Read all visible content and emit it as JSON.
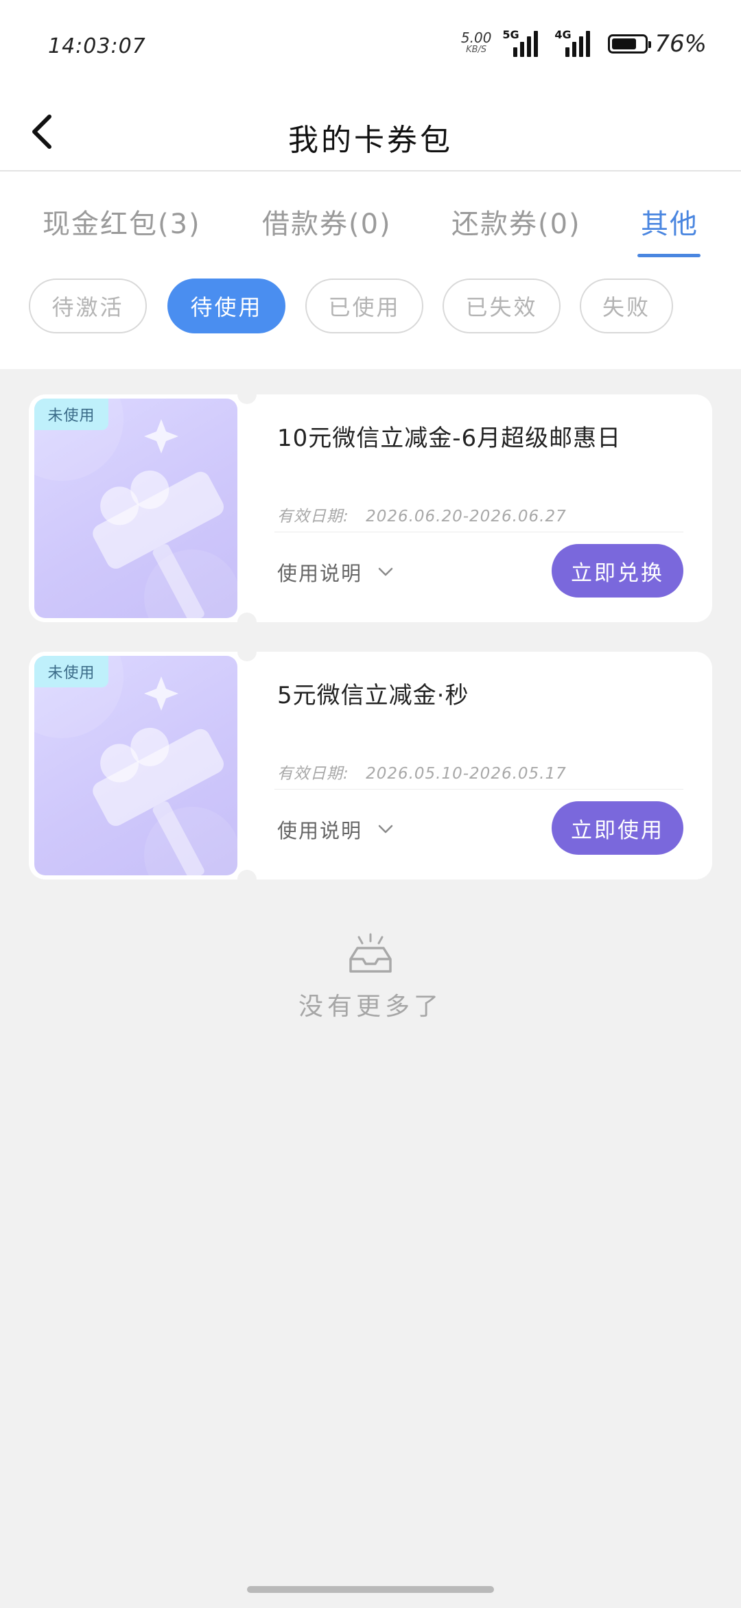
{
  "status_bar": {
    "time": "14:03:07",
    "net_speed_value": "5.00",
    "net_speed_unit": "KB/S",
    "signal_1_label": "5G",
    "signal_2_label": "4G",
    "battery_percent": "76%",
    "battery_level": 0.76
  },
  "header": {
    "title": "我的卡券包"
  },
  "tabs": [
    {
      "label": "现金红包(3)",
      "active": false
    },
    {
      "label": "借款券(0)",
      "active": false
    },
    {
      "label": "还款券(0)",
      "active": false
    },
    {
      "label": "其他",
      "active": true
    }
  ],
  "filters": [
    {
      "label": "待激活",
      "active": false
    },
    {
      "label": "待使用",
      "active": true
    },
    {
      "label": "已使用",
      "active": false
    },
    {
      "label": "已失效",
      "active": false
    },
    {
      "label": "失败",
      "active": false
    }
  ],
  "coupons": [
    {
      "badge": "未使用",
      "title": "10元微信立减金-6月超级邮惠日",
      "validity_label": "有效日期:",
      "validity_range": "2026.06.20-2026.06.27",
      "usage_label": "使用说明",
      "action_label": "立即兑换"
    },
    {
      "badge": "未使用",
      "title": "5元微信立减金·秒",
      "validity_label": "有效日期:",
      "validity_range": "2026.05.10-2026.05.17",
      "usage_label": "使用说明",
      "action_label": "立即使用"
    }
  ],
  "empty_state": {
    "text": "没有更多了",
    "icon": "empty-inbox-icon"
  },
  "colors": {
    "accent_blue": "#4a86e0",
    "action_purple": "#7a68dc",
    "badge_cyan": "#bff0fb"
  }
}
